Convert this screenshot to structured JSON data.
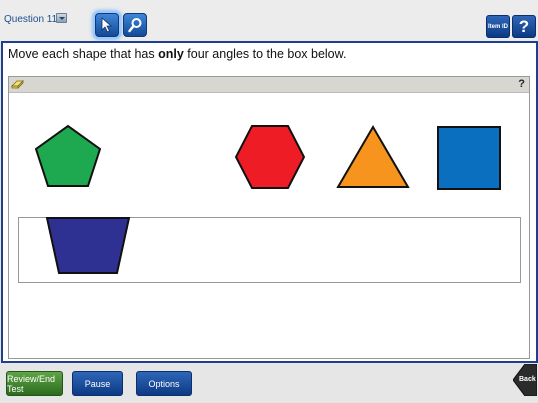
{
  "header": {
    "question_label": "Question 11",
    "tools": [
      {
        "name": "pointer",
        "icon": "arrow-cursor-icon",
        "active": true
      },
      {
        "name": "zoom",
        "icon": "magnifier-icon",
        "active": false
      }
    ],
    "item_id_label": "Item ID",
    "help_label": "?"
  },
  "question": {
    "prompt_before": "Move each shape that has",
    "prompt_bold": "only",
    "prompt_after": "four angles to the box below.",
    "help_mark": "?",
    "shapes": [
      {
        "name": "pentagon",
        "color": "#1ea84f"
      },
      {
        "name": "hexagon",
        "color": "#ee1c25"
      },
      {
        "name": "triangle",
        "color": "#f7941d"
      },
      {
        "name": "square",
        "color": "#0a6fbf"
      }
    ],
    "dropped_shapes": [
      {
        "name": "trapezoid",
        "color": "#2e3192"
      }
    ]
  },
  "footer": {
    "review_label": "Review/End Test",
    "pause_label": "Pause",
    "options_label": "Options",
    "back_label": "Back"
  },
  "colors": {
    "frame_border": "#1c3f8f",
    "button_blue": "#134a96",
    "button_green": "#2c6b1e"
  }
}
